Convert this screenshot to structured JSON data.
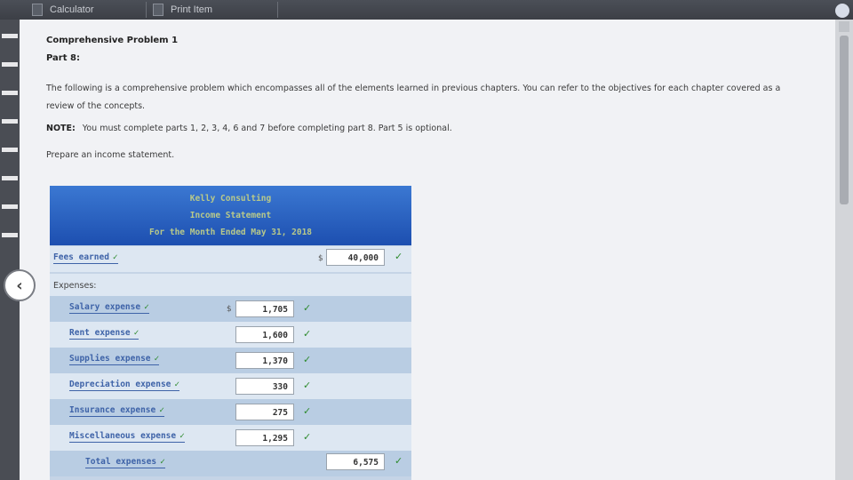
{
  "tabs": [
    {
      "label": "Calculator"
    },
    {
      "label": "Print Item"
    }
  ],
  "problem": {
    "title": "Comprehensive Problem 1",
    "part": "Part 8:",
    "description": "The following is a comprehensive problem which encompasses all of the elements learned in previous chapters. You can refer to the objectives for each chapter covered as a review of the concepts.",
    "note_label": "NOTE:",
    "note_text": "You must complete parts 1, 2, 3, 4, 6 and 7 before completing part 8. Part 5 is optional.",
    "instruction": "Prepare an income statement."
  },
  "statement": {
    "company": "Kelly Consulting",
    "title": "Income Statement",
    "period": "For the Month Ended May 31, 2018",
    "fees_label": "Fees earned",
    "fees_value": "40,000",
    "expenses_label": "Expenses:",
    "currency": "$",
    "check": "✓",
    "expenses": [
      {
        "label": "Salary expense",
        "value": "1,705"
      },
      {
        "label": "Rent expense",
        "value": "1,600"
      },
      {
        "label": "Supplies expense",
        "value": "1,370"
      },
      {
        "label": "Depreciation expense",
        "value": "330"
      },
      {
        "label": "Insurance expense",
        "value": "275"
      },
      {
        "label": "Miscellaneous expense",
        "value": "1,295"
      }
    ],
    "total_label": "Total expenses",
    "total_value": "6,575"
  }
}
